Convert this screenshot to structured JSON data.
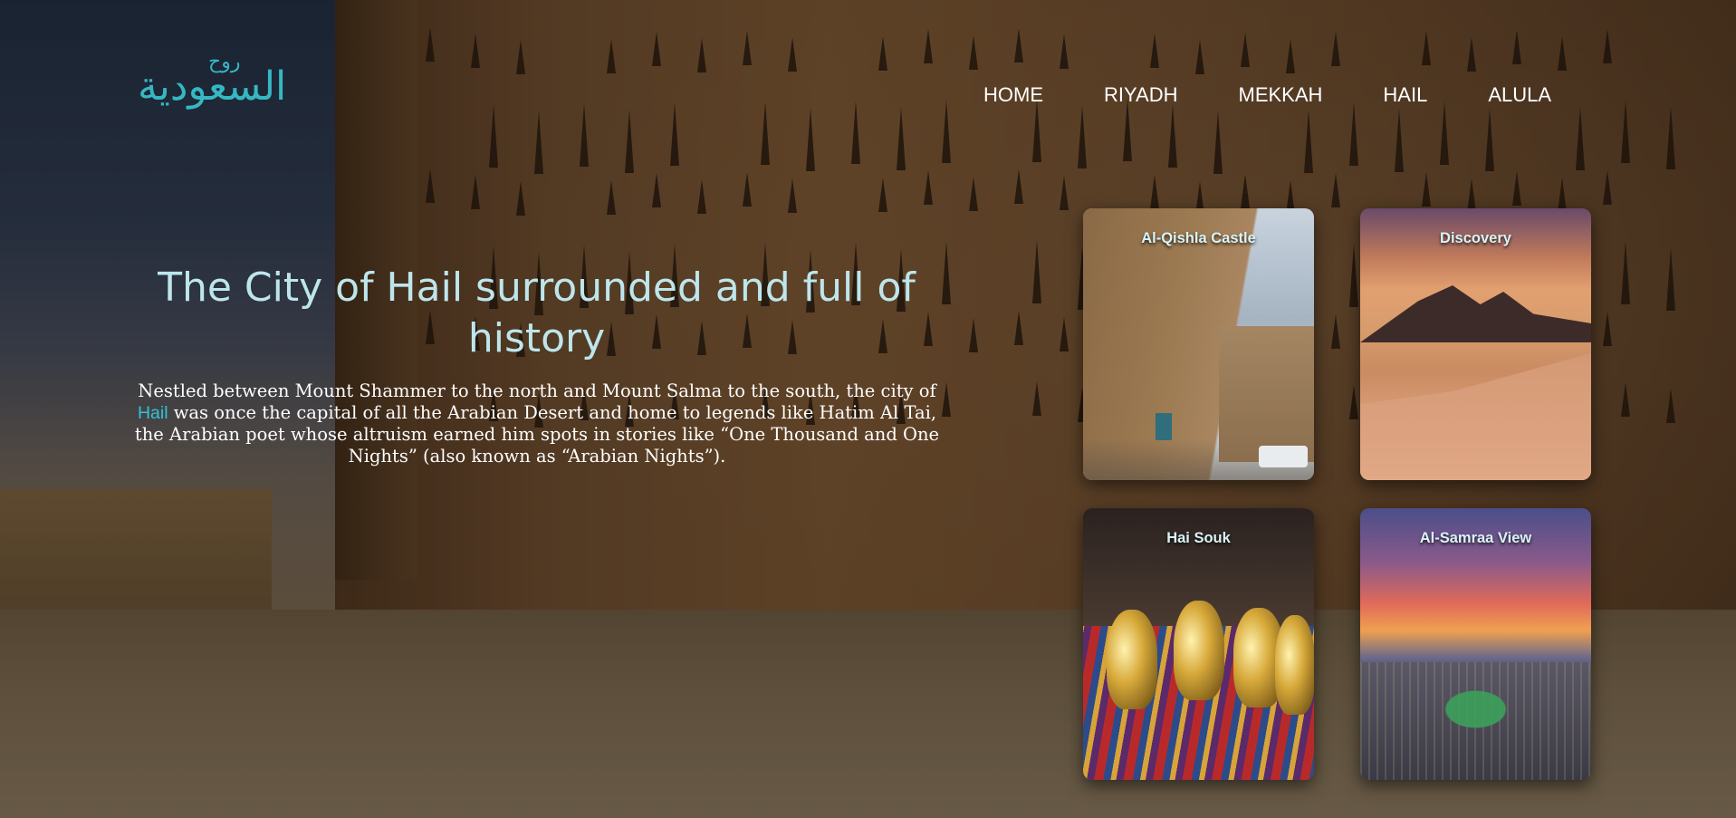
{
  "logo": {
    "arabic_main": "السعودية",
    "arabic_top": "روح"
  },
  "nav": {
    "items": [
      "HOME",
      "RIYADH",
      "MEKKAH",
      "HAIL",
      "ALULA"
    ]
  },
  "hero": {
    "title": "The City of Hail surrounded and full of history",
    "body_before": "Nestled between Mount Shammer to the north and Mount Salma to the south, the city of ",
    "body_link": "Hail",
    "body_after": " was once the capital of all the Arabian Desert and home to legends like Hatim Al Tai, the Arabian poet whose altruism earned him spots in stories like “One Thousand and One Nights” (also known as “Arabian Nights”)."
  },
  "cards": [
    {
      "title": "Al-Qishla Castle"
    },
    {
      "title": "Discovery"
    },
    {
      "title": "Hai Souk"
    },
    {
      "title": "Al-Samraa View"
    }
  ],
  "colors": {
    "accent": "#2fc4d8",
    "title": "#bde6ec"
  }
}
